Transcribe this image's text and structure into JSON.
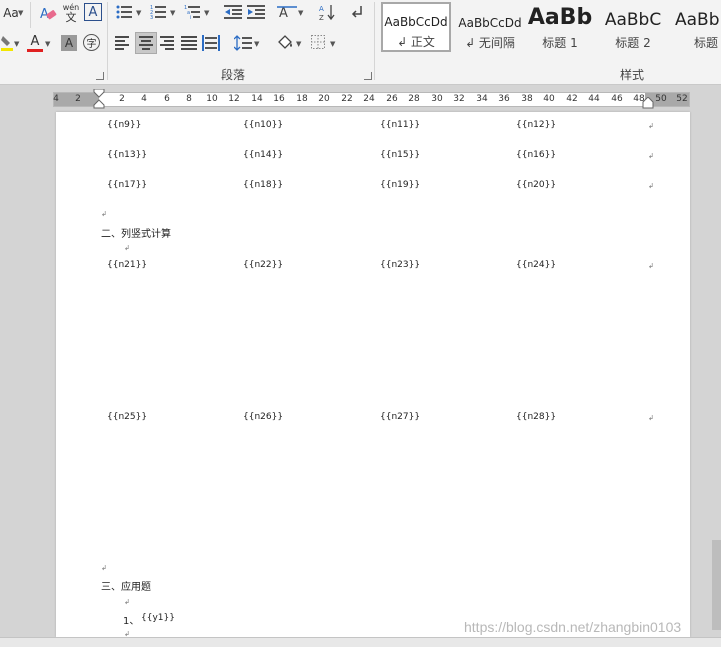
{
  "ribbon": {
    "font": {
      "change_case": "Aa",
      "phonetic_top": "wén",
      "phonetic_bottom": "文",
      "char_border": "A",
      "font_color": "A",
      "char_shading": "A",
      "enclose_char": "字"
    },
    "paragraph": {
      "label": "段落"
    },
    "styles": {
      "label": "样式",
      "items": [
        {
          "sample": "AaBbCcDd",
          "name": "↲ 正文",
          "selected": true
        },
        {
          "sample": "AaBbCcDd",
          "name": "↲ 无间隔"
        },
        {
          "sample": "AaBb",
          "name": "标题 1"
        },
        {
          "sample": "AaBbC",
          "name": "标题 2"
        },
        {
          "sample": "AaBb",
          "name": "标题"
        }
      ]
    },
    "colors": {
      "highlight": "#f2e600",
      "font_red": "#e02020",
      "accent_blue": "#2b6cc4"
    }
  },
  "ruler": {
    "left_ticks": [
      "4",
      "2"
    ],
    "ticks": [
      "2",
      "4",
      "6",
      "8",
      "10",
      "12",
      "14",
      "16",
      "18",
      "20",
      "22",
      "24",
      "26",
      "28",
      "30",
      "32",
      "34",
      "36",
      "38",
      "40",
      "42",
      "44",
      "46",
      "48",
      "50",
      "52"
    ]
  },
  "document": {
    "row1": [
      "{{n9}}",
      "{{n10}}",
      "{{n11}}",
      "{{n12}}"
    ],
    "row2": [
      "{{n13}}",
      "{{n14}}",
      "{{n15}}",
      "{{n16}}"
    ],
    "row3": [
      "{{n17}}",
      "{{n18}}",
      "{{n19}}",
      "{{n20}}"
    ],
    "section2": "二、列竖式计算",
    "row4": [
      "{{n21}}",
      "{{n22}}",
      "{{n23}}",
      "{{n24}}"
    ],
    "row5": [
      "{{n25}}",
      "{{n26}}",
      "{{n27}}",
      "{{n28}}"
    ],
    "section3": "三、应用题",
    "item1_prefix": "1、",
    "item1_value": "{{y1}}",
    "para_mark": "↲"
  },
  "watermark": "https://blog.csdn.net/zhangbin0103"
}
